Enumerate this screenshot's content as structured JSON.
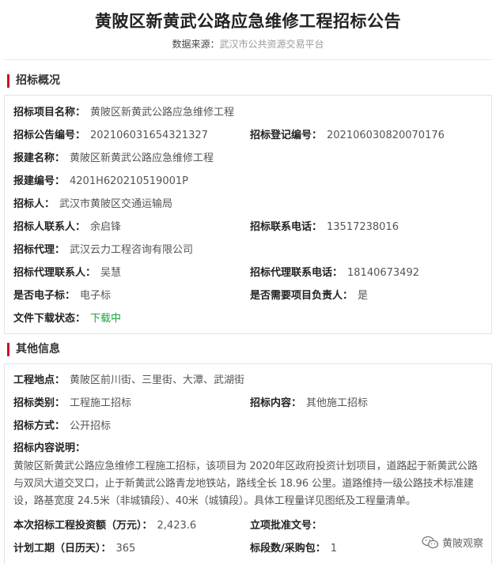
{
  "header": {
    "title": "黄陂区新黄武公路应急维修工程招标公告",
    "source_label": "数据来源：",
    "source_value": "武汉市公共资源交易平台"
  },
  "overview": {
    "heading": "招标概况",
    "fields": {
      "project_name": {
        "label": "招标项目名称：",
        "value": "黄陂区新黄武公路应急维修工程"
      },
      "notice_no": {
        "label": "招标公告编号：",
        "value": "2021060316543213​27"
      },
      "register_no": {
        "label": "招标登记编号：",
        "value": "202106030820070176"
      },
      "build_name": {
        "label": "报建名称：",
        "value": "黄陂区新黄武公路应急维修工程"
      },
      "build_no": {
        "label": "报建编号：",
        "value": "4201H620210519001P"
      },
      "tenderer": {
        "label": "招标人：",
        "value": "武汉市黄陂区交通运输局"
      },
      "contact": {
        "label": "招标人联系人：",
        "value": "余启锋"
      },
      "contact_phone": {
        "label": "招标联系电话：",
        "value": "13517238016"
      },
      "agent": {
        "label": "招标代理：",
        "value": "武汉云力工程咨询有限公司"
      },
      "agent_contact": {
        "label": "招标代理联系人：",
        "value": "吴慧"
      },
      "agent_phone": {
        "label": "招标代理联系电话：",
        "value": "18140673492"
      },
      "electronic": {
        "label": "是否电子标：",
        "value": "电子标"
      },
      "need_leader": {
        "label": "是否需要项目负责人：",
        "value": "是"
      },
      "download_status": {
        "label": "文件下载状态：",
        "value": "下载中"
      }
    }
  },
  "other": {
    "heading": "其他信息",
    "fields": {
      "location": {
        "label": "工程地点：",
        "value": "黄陂区前川街、三里街、大潭、武湖街"
      },
      "category": {
        "label": "招标类别：",
        "value": "工程施工招标"
      },
      "content": {
        "label": "招标内容：",
        "value": "其他施工招标"
      },
      "method": {
        "label": "招标方式：",
        "value": "公开招标"
      },
      "desc_label": {
        "label": "招标内容说明："
      },
      "description": "黄陂区新黄武公路应急维修工程施工招标，该项目为 2020年区政府投资计划项目，道路起于新黄武公路与双凤大道交叉口，止于新黄武公路青龙地铁站，路线全长 18.96 公里。道路维持一级公路技术标准建设，路基宽度 24.5米（非城镇段）、40米（城镇段）。具体工程量详见图纸及工程量清单。",
      "investment": {
        "label": "本次招标工程投资额（万元）：",
        "value": "2,423.6"
      },
      "approval_no": {
        "label": "立项批准文号：",
        "value": ""
      },
      "duration": {
        "label": "计划工期（日历天）：",
        "value": "365"
      },
      "lots": {
        "label": "标段数/采购包：",
        "value": "1"
      }
    }
  },
  "watermark": {
    "text": "黄陂观察",
    "icon": "wechat-icon"
  },
  "colors": {
    "accent": "#c8102e",
    "status_green": "#17a33a"
  }
}
